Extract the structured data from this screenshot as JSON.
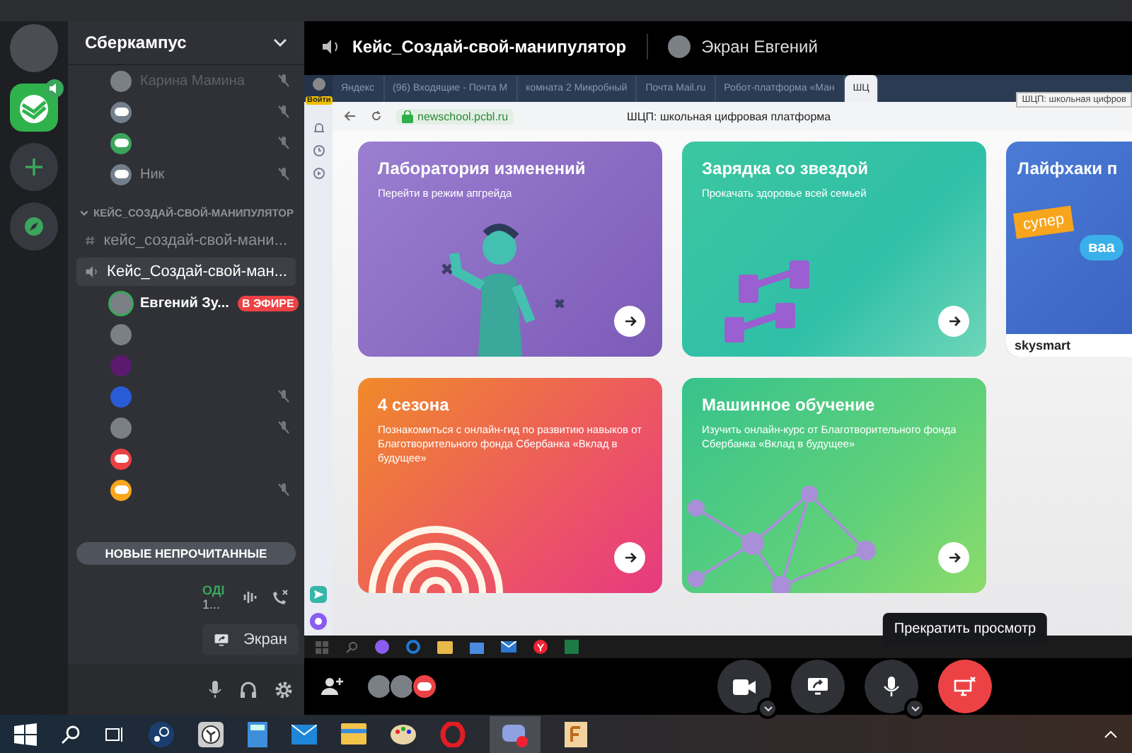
{
  "header": {
    "channel": "Кейс_Создай-свой-манипулятор",
    "stream_label": "Экран Евгений"
  },
  "server": {
    "name": "Сберкампус"
  },
  "top_users": [
    {
      "name": "Карина Мамина",
      "kind": "photo",
      "muted": true
    },
    {
      "kind": "discord",
      "color": "#747f8d",
      "muted": true
    },
    {
      "kind": "discord",
      "color": "#3ba55c",
      "muted": true
    },
    {
      "name": "Ник",
      "kind": "discord",
      "color": "#747f8d",
      "muted": true
    }
  ],
  "category": {
    "name": "КЕЙС_СОЗДАЙ-СВОЙ-МАНИПУЛЯТОР",
    "expanded": true
  },
  "channels": [
    {
      "kind": "text",
      "name": "кейс_создай-свой-мани...",
      "selected": false
    },
    {
      "kind": "voice",
      "name": "Кейс_Создай-свой-ман...",
      "selected": true
    }
  ],
  "voice_users": [
    {
      "name": "Евгений Зу...",
      "kind": "photo",
      "live": "В ЭФИРЕ",
      "muted": false
    },
    {
      "kind": "photo",
      "muted": false
    },
    {
      "kind": "plain",
      "color": "#5b1a6e",
      "muted": false
    },
    {
      "kind": "plain",
      "color": "#2a5bd7",
      "muted": true
    },
    {
      "kind": "photo",
      "muted": true
    },
    {
      "kind": "discord",
      "color": "#ed4245",
      "muted": false
    },
    {
      "kind": "discord",
      "color": "#faa61a",
      "muted": true
    }
  ],
  "new_unread": "НОВЫЕ НЕПРОЧИТАННЫЕ",
  "voice_panel": {
    "status": "ОДІ",
    "channel": "1..."
  },
  "screen_button": "Экран",
  "browser": {
    "login": "Войти",
    "tabs": [
      {
        "label": "Яндекс",
        "selected": false
      },
      {
        "label": "(96) Входящие - Почта М",
        "selected": false
      },
      {
        "label": "комната 2 Микробный",
        "selected": false
      },
      {
        "label": "Почта Mail.ru",
        "selected": false
      },
      {
        "label": "Робот-платформа «Ман",
        "selected": false
      },
      {
        "label": "ШЦ",
        "selected": true
      }
    ],
    "tab_tooltip": "ШЦП: школьная цифров",
    "url": "newschool.pcbl.ru",
    "page_title": "ШЦП: школьная цифровая платформа",
    "cards": [
      {
        "kind": "person",
        "title": "Лаборатория изменений",
        "subtitle": "Перейти в режим апгрейда"
      },
      {
        "kind": "dumbbells",
        "title": "Зарядка со звездой",
        "subtitle": "Прокачать здоровье всей семьей"
      },
      {
        "kind": "ad",
        "title": "Лайфхаки п",
        "badge": "супер",
        "bubble": "ваа",
        "brand": "skysmart"
      },
      {
        "kind": "fingerprint",
        "title": "4 сезона",
        "subtitle": "Познакомиться с онлайн-гид по развитию навыков от Благотворительного фонда Сбербанка «Вклад в будущее»"
      },
      {
        "kind": "network",
        "title": "Машинное обучение",
        "subtitle": "Изучить онлайн-курс от Благотворительного фонда Сбербанка «Вклад в будущее»"
      }
    ]
  },
  "participants": [
    {
      "kind": "photo"
    },
    {
      "kind": "photo"
    },
    {
      "kind": "discord",
      "color": "#ed4245"
    }
  ],
  "call_controls": [
    {
      "kind": "camera",
      "menu": true
    },
    {
      "kind": "share",
      "menu": false
    },
    {
      "kind": "mic",
      "menu": true
    },
    {
      "kind": "stop",
      "menu": false
    }
  ],
  "stop_tooltip": "Прекратить просмотр"
}
